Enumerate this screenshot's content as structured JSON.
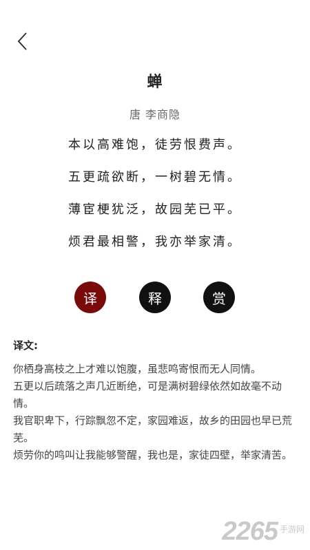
{
  "header": {
    "back_icon": "chevron-left-icon"
  },
  "poem": {
    "title": "蝉",
    "author": "唐 李商隐",
    "lines": [
      "本以高难饱，徒劳恨费声。",
      "五更疏欲断，一树碧无情。",
      "薄宦梗犹泛，故园芜已平。",
      "烦君最相警，我亦举家清。"
    ]
  },
  "actions": [
    {
      "label": "译",
      "color": "#7a0a0a",
      "active": true
    },
    {
      "label": "释",
      "color": "#111111",
      "active": false
    },
    {
      "label": "赏",
      "color": "#111111",
      "active": false
    }
  ],
  "section": {
    "title": "译文:",
    "paragraphs": [
      "你栖身高枝之上才难以饱腹，虽悲鸣寄恨而无人同情。",
      "五更以后疏落之声几近断绝，可是满树碧绿依然如故毫不动情。",
      "我官职卑下，行踪飘忽不定，家园难返，故乡的田园也早已荒芜。",
      "烦劳你的鸣叫让我能够警醒，我也是，家徒四壁，举家清苦。"
    ]
  },
  "watermark": {
    "number": "2265",
    "text": "手游网"
  }
}
